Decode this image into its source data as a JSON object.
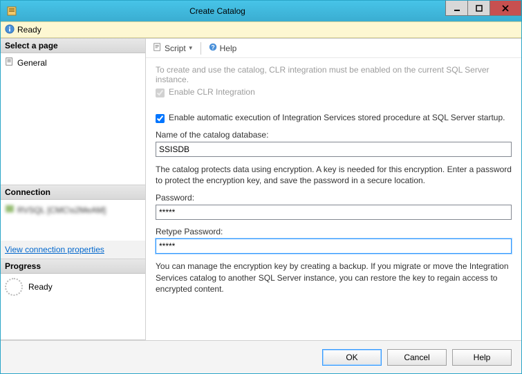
{
  "window": {
    "title": "Create Catalog"
  },
  "status": {
    "text": "Ready"
  },
  "sidebar": {
    "select_page": {
      "header": "Select a page",
      "items": [
        {
          "label": "General"
        }
      ]
    },
    "connection": {
      "header": "Connection",
      "server": "RVSQL [CMC\\s2MeAM]",
      "link": "View connection properties"
    },
    "progress": {
      "header": "Progress",
      "text": "Ready"
    }
  },
  "toolbar": {
    "script": "Script",
    "help": "Help"
  },
  "form": {
    "intro": "To create and use the catalog, CLR integration must be enabled on the current SQL Server instance.",
    "enable_clr": "Enable CLR Integration",
    "enable_auto": "Enable automatic execution of Integration Services stored procedure at SQL Server startup.",
    "db_label": "Name of the catalog database:",
    "db_value": "SSISDB",
    "encrypt_desc": "The catalog protects data using encryption. A key is needed for this encryption. Enter a password to protect the encryption key, and save the password in a secure location.",
    "pwd_label": "Password:",
    "pwd_value": "*****",
    "retype_label": "Retype Password:",
    "retype_value": "*****",
    "backup_desc": "You can manage the encryption key by creating a backup. If you migrate or move the Integration Services catalog to another SQL Server instance, you can restore the key to regain access to encrypted content."
  },
  "footer": {
    "ok": "OK",
    "cancel": "Cancel",
    "help": "Help"
  }
}
